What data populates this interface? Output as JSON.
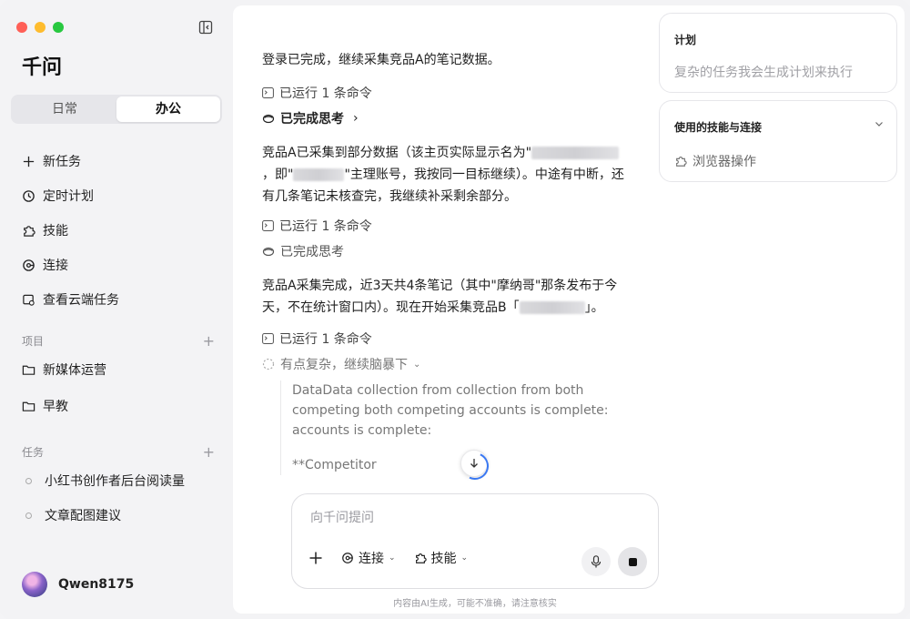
{
  "app": {
    "title": "千问"
  },
  "mode_tabs": [
    {
      "label": "日常"
    },
    {
      "label": "办公"
    }
  ],
  "nav": [
    {
      "label": "新任务",
      "icon": "plus-icon"
    },
    {
      "label": "定时计划",
      "icon": "clock-icon"
    },
    {
      "label": "技能",
      "icon": "puzzle-icon"
    },
    {
      "label": "连接",
      "icon": "connect-icon"
    },
    {
      "label": "查看云端任务",
      "icon": "cloud-task-icon"
    }
  ],
  "projects": {
    "header": "项目",
    "items": [
      {
        "label": "新媒体运营"
      },
      {
        "label": "早教"
      }
    ]
  },
  "tasks": {
    "header": "任务",
    "items": [
      {
        "label": "小红书创作者后台阅读量"
      },
      {
        "label": "文章配图建议"
      }
    ]
  },
  "user": {
    "name": "Qwen8175"
  },
  "chat": {
    "msg1": "登录已完成，继续采集竞品A的笔记数据。",
    "run_label": "已运行 1 条命令",
    "think_done": "已完成思考",
    "msg2_a": "竞品A已采集到部分数据（该主页实际显示名为\"",
    "msg2_b": "，即\"",
    "msg2_c": "\"主理账号，我按同一目标继续）。中途有中断，还有几条笔记未核查完，我继续补采剩余部分。",
    "msg3_a": "竞品A采集完成，近3天共4条笔记（其中\"摩纳哥\"那条发布于今天，不在统计窗口内）。现在开始采集竞品B「",
    "msg3_b": "」。",
    "brainstorm": "有点复杂，继续脑暴下",
    "brainstorm_text": "DataData collection from collection from both competing both competing accounts is complete: accounts is complete:",
    "brainstorm_text2": "**Competitor"
  },
  "composer": {
    "placeholder": "向千问提问",
    "connect": "连接",
    "skills": "技能",
    "disclaimer": "内容由AI生成，可能不准确，请注意核实"
  },
  "right": {
    "plan_title": "计划",
    "plan_sub": "复杂的任务我会生成计划来执行",
    "skills_title": "使用的技能与连接",
    "skill_item": "浏览器操作"
  }
}
